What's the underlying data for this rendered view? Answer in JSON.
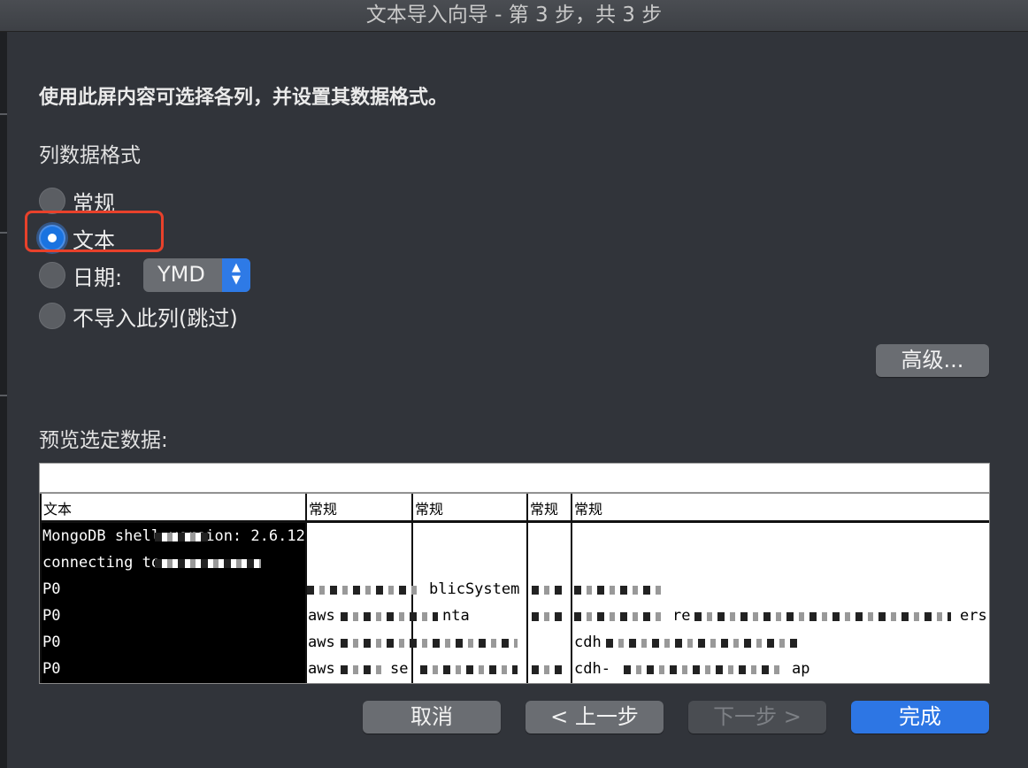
{
  "window": {
    "title": "文本导入向导 - 第 3 步，共 3 步"
  },
  "instruction": "使用此屏内容可选择各列，并设置其数据格式。",
  "format_section": {
    "label": "列数据格式",
    "options": [
      {
        "label": "常规",
        "checked": false
      },
      {
        "label": "文本",
        "checked": true
      },
      {
        "label": "日期:",
        "checked": false
      },
      {
        "label": "不导入此列(跳过)",
        "checked": false
      }
    ],
    "date_select": {
      "value": "YMD"
    },
    "highlight_color": "#e8412b"
  },
  "advanced_button": "高级...",
  "preview": {
    "label": "预览选定数据:",
    "columns": [
      "文本",
      "常规",
      "常规",
      "常规",
      "常规"
    ],
    "rows": [
      [
        "MongoDB shell version: 2.6.12",
        "",
        "",
        "",
        ""
      ],
      [
        "connecting to",
        "",
        "",
        "",
        ""
      ],
      [
        "P0",
        "",
        "blicSystem",
        "",
        ""
      ],
      [
        "P0",
        "aws",
        "nta",
        "",
        "ers"
      ],
      [
        "P0",
        "aws",
        "",
        "",
        "cdh"
      ],
      [
        "P0",
        "aws",
        "se",
        "",
        "cdh-"
      ]
    ],
    "row_extra": [
      "re",
      "ap"
    ]
  },
  "buttons": {
    "cancel": "取消",
    "back": "< 上一步",
    "next": "下一步 >",
    "finish": "完成"
  },
  "colors": {
    "accent": "#2d76e4",
    "background": "#31343a"
  }
}
